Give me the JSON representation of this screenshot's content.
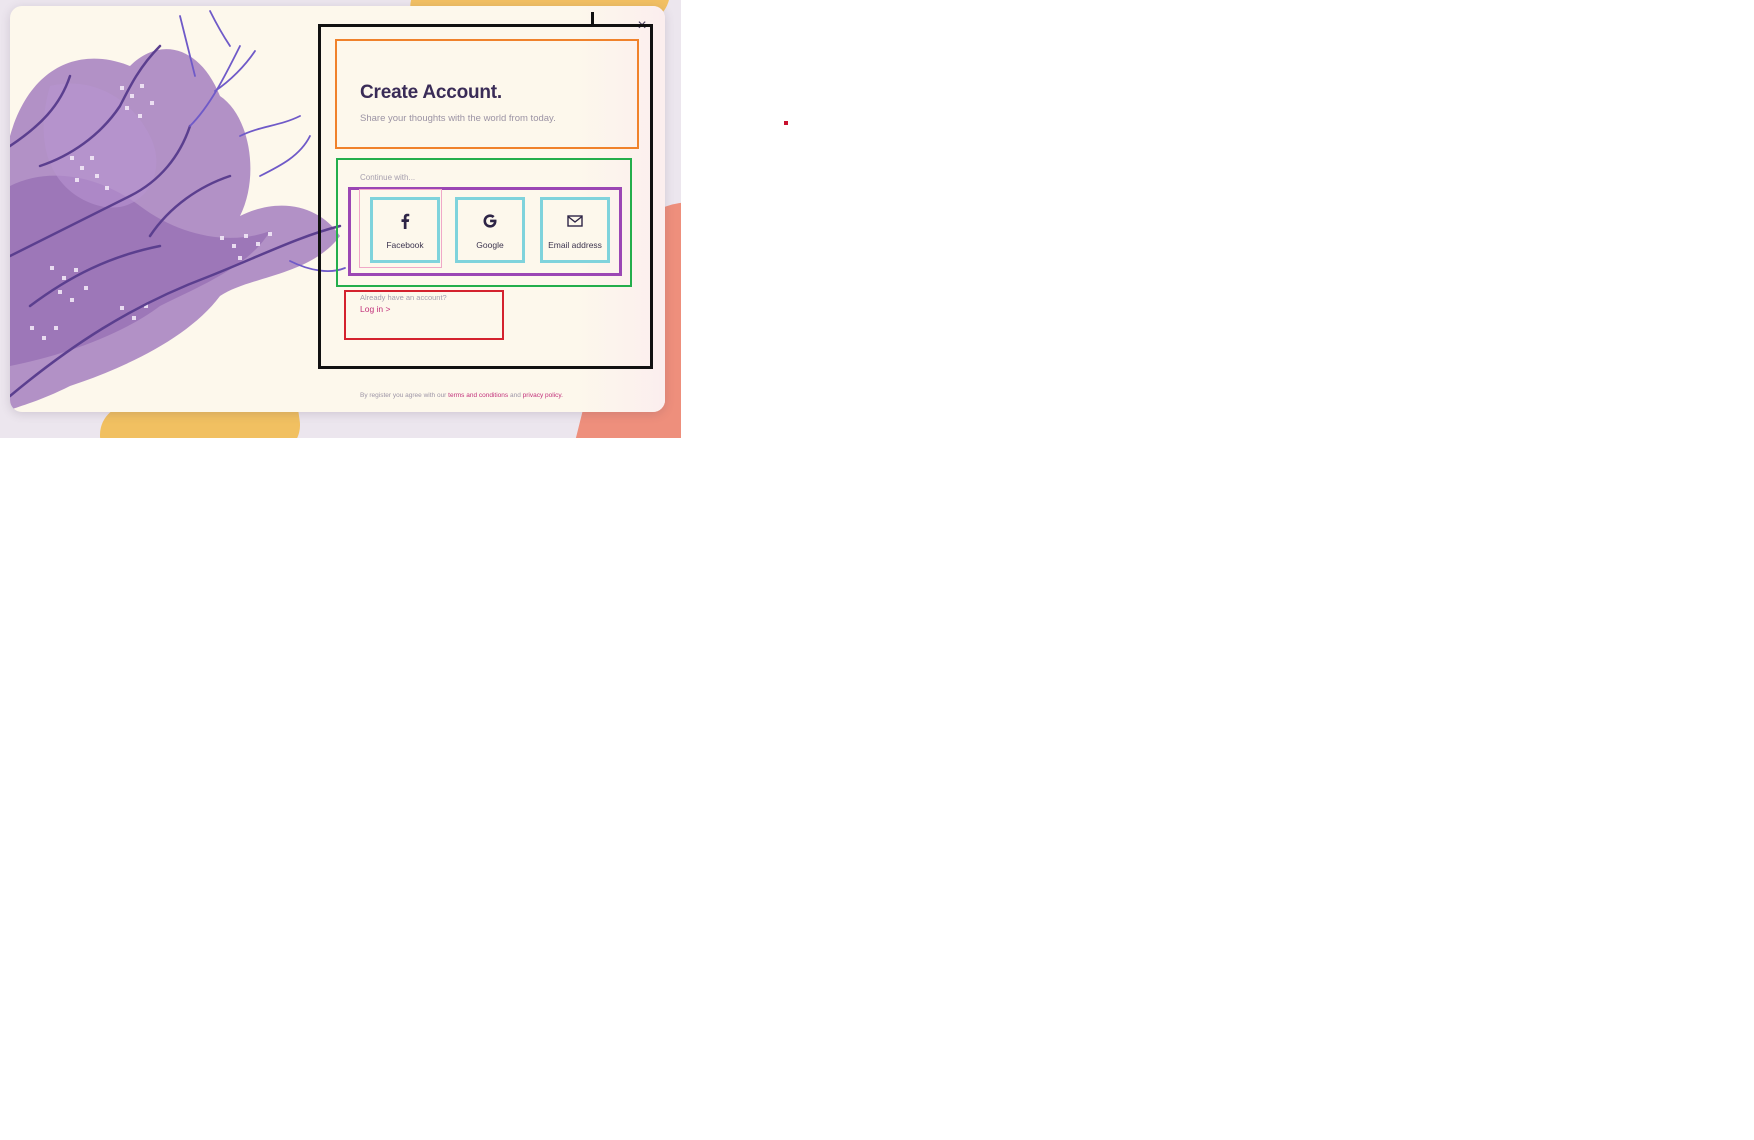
{
  "dialog": {
    "close_glyph": "×",
    "title": "Create Account.",
    "subtitle": "Share your thoughts with the world from today.",
    "continue_label": "Continue with...",
    "options": [
      {
        "label": "Facebook",
        "icon": "facebook-icon"
      },
      {
        "label": "Google",
        "icon": "google-icon"
      },
      {
        "label": "Email address",
        "icon": "mail-icon"
      }
    ],
    "already_text": "Already have an account?",
    "login_link": "Log in >",
    "terms": {
      "prefix": "By register you agree with our",
      "terms_link": "terms and conditions",
      "and": "and",
      "privacy_link": "privacy policy."
    }
  },
  "colors": {
    "modal_bg": "#fdf8ec",
    "title": "#3a2c57",
    "accent_link": "#c2317b",
    "art_purple": "#9a72b6",
    "art_vein": "#6a4fb8"
  }
}
